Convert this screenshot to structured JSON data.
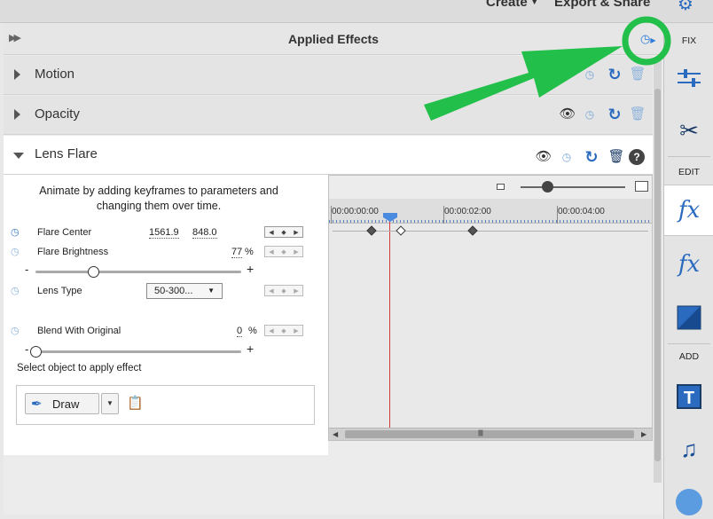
{
  "topbar": {
    "create_label": "Create",
    "export_label": "Export & Share"
  },
  "panel": {
    "title": "Applied Effects",
    "collapse_icon": "double-chevron-icon",
    "keyframe_toggle_icon": "stopwatch-icon"
  },
  "effects": [
    {
      "name": "Motion",
      "expanded": false
    },
    {
      "name": "Opacity",
      "expanded": false
    },
    {
      "name": "Lens Flare",
      "expanded": true
    }
  ],
  "lens_flare": {
    "hint": "Animate by adding keyframes to parameters and changing them over time.",
    "params": {
      "flare_center": {
        "label": "Flare Center",
        "x": "1561.9",
        "y": "848.0"
      },
      "flare_brightness": {
        "label": "Flare Brightness",
        "value": "77",
        "unit": "%",
        "slider_fraction": 0.28
      },
      "lens_type": {
        "label": "Lens Type",
        "value": "50-300..."
      },
      "blend": {
        "label": "Blend With Original",
        "value": "0",
        "unit": "%",
        "slider_fraction": 0.0
      }
    },
    "slider_minus": "-",
    "slider_plus": "+",
    "select_hint": "Select object to apply effect",
    "draw_label": "Draw"
  },
  "timeline": {
    "ruler_labels": [
      "00:00:00:00",
      "00:00:02:00",
      "00:00:04:00"
    ],
    "zoom_fraction": 0.25
  },
  "sidebar": {
    "fix_label": "FIX",
    "edit_label": "EDIT",
    "add_label": "ADD",
    "fx_label": "fx"
  },
  "colors": {
    "accent": "#2a6bbf",
    "annotation": "#22c04a",
    "playhead": "#d23a3a"
  }
}
